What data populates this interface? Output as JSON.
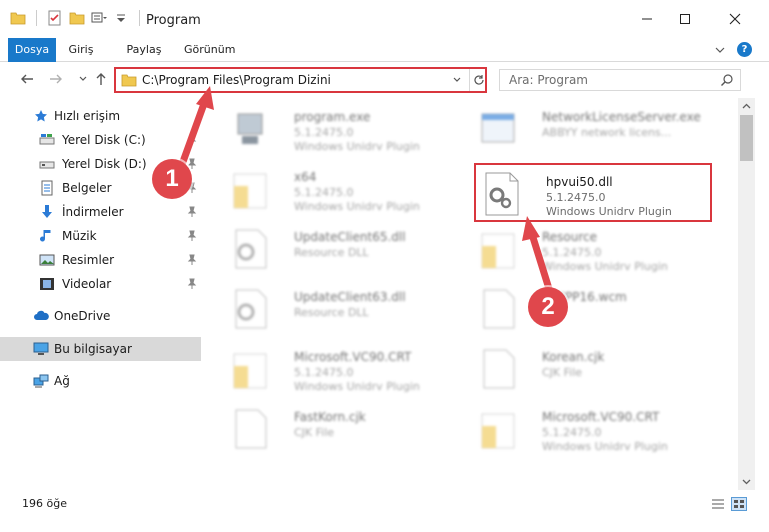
{
  "window": {
    "title": "Program",
    "controls": {
      "minimize": "minimize",
      "maximize": "maximize",
      "close": "close"
    }
  },
  "ribbon": {
    "tabs": [
      {
        "label": "Dosya",
        "active": true
      },
      {
        "label": "Giriş"
      },
      {
        "label": "Paylaş"
      },
      {
        "label": "Görünüm"
      }
    ],
    "help": "?"
  },
  "address": {
    "path": "C:\\Program Files\\Program Dizini",
    "search_placeholder": "Ara: Program"
  },
  "sidebar": {
    "items": [
      {
        "label": "Hızlı erişim",
        "icon": "star-icon"
      },
      {
        "label": "Yerel Disk (C:)",
        "icon": "drive-icon",
        "pinned": true
      },
      {
        "label": "Yerel Disk (D:)",
        "icon": "drive-icon",
        "pinned": true
      },
      {
        "label": "Belgeler",
        "icon": "documents-icon",
        "pinned": true
      },
      {
        "label": "İndirmeler",
        "icon": "download-icon",
        "pinned": true
      },
      {
        "label": "Müzik",
        "icon": "music-icon",
        "pinned": true
      },
      {
        "label": "Resimler",
        "icon": "pictures-icon",
        "pinned": true
      },
      {
        "label": "Videolar",
        "icon": "video-icon",
        "pinned": true
      },
      {
        "label": "OneDrive",
        "icon": "cloud-icon"
      },
      {
        "label": "Bu bilgisayar",
        "icon": "computer-icon",
        "selected": true
      },
      {
        "label": "Ağ",
        "icon": "network-icon"
      }
    ]
  },
  "files": {
    "left": [
      {
        "name": "program.exe",
        "meta1": "5.1.2475.0",
        "meta2": "Windows Unidrv Plugin",
        "icon": "exe-icon"
      },
      {
        "name": "x64",
        "meta1": "5.1.2475.0",
        "meta2": "Windows Unidrv Plugin",
        "icon": "folder-file-icon"
      },
      {
        "name": "UpdateClient65.dll",
        "meta1": "Resource DLL",
        "meta2": "",
        "icon": "dll-icon"
      },
      {
        "name": "UpdateClient63.dll",
        "meta1": "Resource DLL",
        "meta2": "",
        "icon": "dll-icon"
      },
      {
        "name": "Microsoft.VC90.CRT",
        "meta1": "5.1.2475.0",
        "meta2": "Windows Unidrv Plugin",
        "icon": "folder-file-icon"
      },
      {
        "name": "FastKorn.cjk",
        "meta1": "CJK File",
        "meta2": "",
        "icon": "blank-file-icon"
      }
    ],
    "right": [
      {
        "name": "NetworkLicenseServer.exe",
        "meta1": "ABBYY network licens...",
        "meta2": "",
        "icon": "exe-window-icon"
      },
      {
        "name": "hpvui50.dll",
        "meta1": "5.1.2475.0",
        "meta2": "Windows Unidrv Plugin",
        "icon": "dll-gear-icon",
        "focus": true
      },
      {
        "name": "Resource",
        "meta1": "5.1.2475.0",
        "meta2": "Windows Unidrv Plugin",
        "icon": "folder-file-icon"
      },
      {
        "name": "SZPPP16.wcm",
        "meta1": "",
        "meta2": "",
        "icon": "blank-file-icon"
      },
      {
        "name": "Korean.cjk",
        "meta1": "CJK File",
        "meta2": "",
        "icon": "blank-file-icon"
      },
      {
        "name": "Microsoft.VC90.CRT",
        "meta1": "5.1.2475.0",
        "meta2": "Windows Unidrv Plugin",
        "icon": "folder-file-icon"
      }
    ]
  },
  "status": {
    "count": "196 öğe"
  },
  "annotations": {
    "step1": "1",
    "step2": "2"
  },
  "colors": {
    "accent": "#1979ca",
    "highlight": "#d9363e",
    "callout": "#e0474c",
    "selected": "#d9d9d9"
  }
}
